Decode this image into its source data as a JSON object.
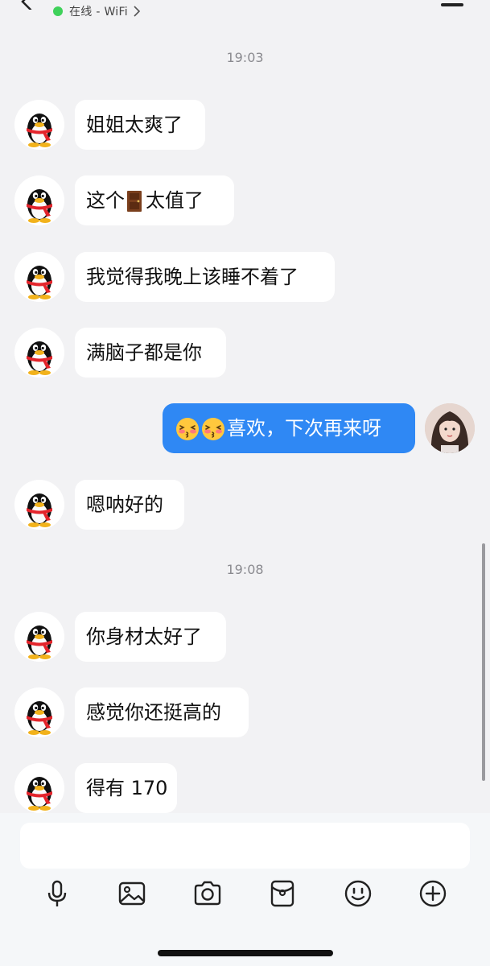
{
  "header": {
    "status_text": "在线 - WiFi",
    "status_color": "#3fd15a"
  },
  "timestamps": [
    "19:03",
    "19:08"
  ],
  "messages": [
    {
      "side": "in",
      "text": "姐姐太爽了"
    },
    {
      "side": "in",
      "pre": "这个",
      "emoji": "door",
      "post": "太值了"
    },
    {
      "side": "in",
      "text": "我觉得我晚上该睡不着了"
    },
    {
      "side": "in",
      "text": "满脑子都是你"
    },
    {
      "side": "out",
      "emoji": "blushing-kiss-face x2",
      "text": "喜欢，下次再来呀"
    },
    {
      "side": "in",
      "text": "嗯呐好的"
    },
    {
      "side": "in",
      "text": "你身材太好了"
    },
    {
      "side": "in",
      "text": "感觉你还挺高的"
    },
    {
      "side": "in",
      "text": "得有 170"
    }
  ],
  "composer": {
    "input_value": "",
    "tools": [
      "microphone-icon",
      "image-icon",
      "camera-icon",
      "red-packet-icon",
      "emoji-icon",
      "plus-icon"
    ]
  },
  "colors": {
    "background": "#f2f2f4",
    "incoming_bubble": "#ffffff",
    "outgoing_bubble": "#2f88f4"
  }
}
